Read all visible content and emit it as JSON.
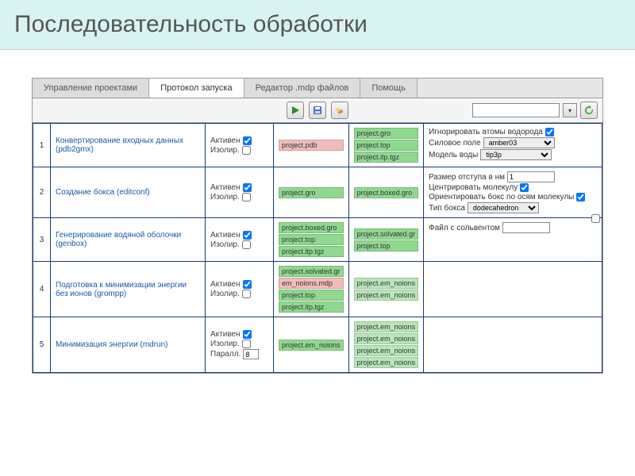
{
  "title": "Последовательность обработки",
  "tabs": [
    "Управление проектами",
    "Протокол запуска",
    "Редактор .mdp файлов",
    "Помощь"
  ],
  "active_tab": 1,
  "toolbar": {
    "search_value": ""
  },
  "steps": [
    {
      "num": "1",
      "name": "Конвертирование входных данных (pdb2gmx)",
      "flags": {
        "active_label": "Активен",
        "active": true,
        "isol_label": "Изолир.",
        "isol": false
      },
      "in": [
        {
          "t": "project.pdb",
          "c": "p"
        }
      ],
      "out": [
        {
          "t": "project.gro",
          "c": "g"
        },
        {
          "t": "project.top",
          "c": "g"
        },
        {
          "t": "project.itp.tgz",
          "c": "g"
        }
      ],
      "params": [
        {
          "label": "Игнорировать атомы водорода",
          "kind": "cb",
          "checked": true
        },
        {
          "label": "Силовое поле",
          "kind": "sel",
          "value": "amber03"
        },
        {
          "label": "Модель воды",
          "kind": "sel",
          "value": "tip3p"
        }
      ],
      "edge_cb": false
    },
    {
      "num": "2",
      "name": "Создание бокса (editconf)",
      "flags": {
        "active_label": "Активен",
        "active": true,
        "isol_label": "Изолир.",
        "isol": false
      },
      "in": [
        {
          "t": "project.gro",
          "c": "g"
        }
      ],
      "out": [
        {
          "t": "project.boxed.gro",
          "c": "g"
        }
      ],
      "params": [
        {
          "label": "Размер отступа в нм",
          "kind": "txt",
          "value": "1"
        },
        {
          "label": "Центрировать молекулу",
          "kind": "cb",
          "checked": true
        },
        {
          "label": "Ориентировать бокс по осям молекулы",
          "kind": "cb",
          "checked": true
        },
        {
          "label": "Тип бокса",
          "kind": "sel",
          "value": "dodecahedron"
        }
      ],
      "edge_cb": true
    },
    {
      "num": "3",
      "name": "Генерирование водяной оболочки (genbox)",
      "flags": {
        "active_label": "Активен",
        "active": true,
        "isol_label": "Изолир.",
        "isol": false
      },
      "in": [
        {
          "t": "project.boxed.gro",
          "c": "g"
        },
        {
          "t": "project.top",
          "c": "g"
        },
        {
          "t": "project.itp.tgz",
          "c": "g"
        }
      ],
      "out": [
        {
          "t": "project.solvated.gr",
          "c": "g"
        },
        {
          "t": "project.top",
          "c": "g"
        }
      ],
      "params": [
        {
          "label": "Файл с сольвентом",
          "kind": "txt",
          "value": ""
        }
      ],
      "edge_cb": false
    },
    {
      "num": "4",
      "name": "Подготовка к минимизации энергии без ионов (grompp)",
      "flags": {
        "active_label": "Активен",
        "active": true,
        "isol_label": "Изолир.",
        "isol": false
      },
      "in": [
        {
          "t": "project.solvated.gr",
          "c": "g"
        },
        {
          "t": "em_noions.mdp",
          "c": "p"
        },
        {
          "t": "project.top",
          "c": "g"
        },
        {
          "t": "project.itp.tgz",
          "c": "g"
        }
      ],
      "out": [
        {
          "t": "project.em_noions",
          "c": "gl"
        },
        {
          "t": "project.em_noions",
          "c": "gl"
        }
      ],
      "params": [],
      "edge_cb": false
    },
    {
      "num": "5",
      "name": "Минимизация энергии (mdrun)",
      "flags": {
        "active_label": "Активен",
        "active": true,
        "isol_label": "Изолир.",
        "isol": false,
        "par_label": "Паралл.",
        "par_value": "8"
      },
      "in": [
        {
          "t": "project.em_noions",
          "c": "g"
        }
      ],
      "out": [
        {
          "t": "project.em_noions",
          "c": "gl"
        },
        {
          "t": "project.em_noions",
          "c": "gl"
        },
        {
          "t": "project.em_noions",
          "c": "gl"
        },
        {
          "t": "project.em_noions",
          "c": "gl"
        }
      ],
      "params": [],
      "edge_cb": false
    }
  ]
}
